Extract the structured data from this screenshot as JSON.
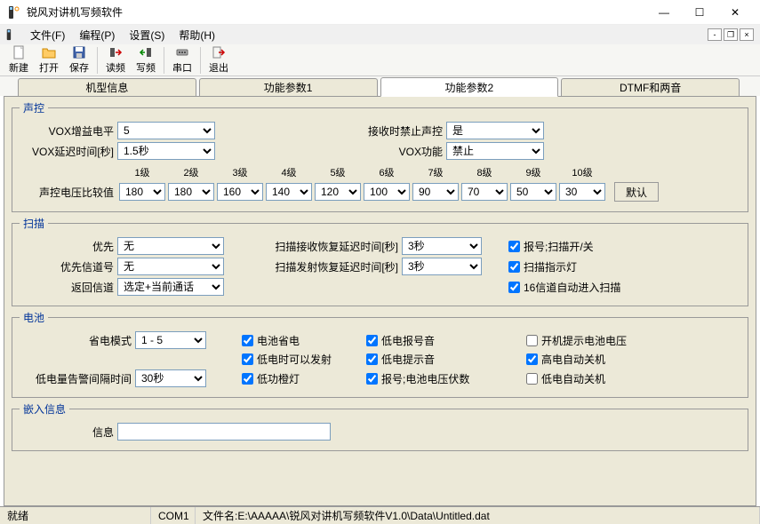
{
  "window": {
    "title": "锐风对讲机写频软件"
  },
  "menu": {
    "file": "文件(F)",
    "program": "编程(P)",
    "settings": "设置(S)",
    "help": "帮助(H)"
  },
  "toolbar": {
    "new": "新建",
    "open": "打开",
    "save": "保存",
    "read": "读频",
    "write": "写频",
    "serial": "串口",
    "exit": "退出"
  },
  "tabs": {
    "model": "机型信息",
    "func1": "功能参数1",
    "func2": "功能参数2",
    "dtmf": "DTMF和两音"
  },
  "vox": {
    "legend": "声控",
    "gain_label": "VOX增益电平",
    "gain_value": "5",
    "delay_label": "VOX延迟时间[秒]",
    "delay_value": "1.5秒",
    "rx_disable_label": "接收时禁止声控",
    "rx_disable_value": "是",
    "vox_func_label": "VOX功能",
    "vox_func_value": "禁止",
    "cmp_label": "声控电压比较值",
    "levels": [
      "1级",
      "2级",
      "3级",
      "4级",
      "5级",
      "6级",
      "7级",
      "8级",
      "9级",
      "10级"
    ],
    "level_values": [
      "180",
      "180",
      "160",
      "140",
      "120",
      "100",
      "90",
      "70",
      "50",
      "30"
    ],
    "default_btn": "默认"
  },
  "scan": {
    "legend": "扫描",
    "priority_label": "优先",
    "priority_value": "无",
    "priority_ch_label": "优先信道号",
    "priority_ch_value": "无",
    "return_ch_label": "返回信道",
    "return_ch_value": "选定+当前通话",
    "rx_resume_label": "扫描接收恢复延迟时间[秒]",
    "rx_resume_value": "3秒",
    "tx_resume_label": "扫描发射恢复延迟时间[秒]",
    "tx_resume_value": "3秒",
    "chk_beep": "报号;扫描开/关",
    "chk_led": "扫描指示灯",
    "chk_ch16": "16信道自动进入扫描"
  },
  "battery": {
    "legend": "电池",
    "save_mode_label": "省电模式",
    "save_mode_value": "1 - 5",
    "low_interval_label": "低电量告警间隔时间",
    "low_interval_value": "30秒",
    "chk_save": "电池省电",
    "chk_low_tx": "低电时可以发射",
    "chk_low_led": "低功橙灯",
    "chk_low_beep": "低电报号音",
    "chk_low_tone": "低电提示音",
    "chk_beep_volt": "报号;电池电压伏数",
    "chk_poweron_volt": "开机提示电池电压",
    "chk_high_off": "高电自动关机",
    "chk_low_off": "低电自动关机"
  },
  "embed": {
    "legend": "嵌入信息",
    "info_label": "信息",
    "info_value": ""
  },
  "status": {
    "ready": "就绪",
    "port": "COM1",
    "file_label": "文件名:",
    "file_path": "E:\\AAAAA\\锐风对讲机写频软件V1.0\\Data\\Untitled.dat"
  }
}
